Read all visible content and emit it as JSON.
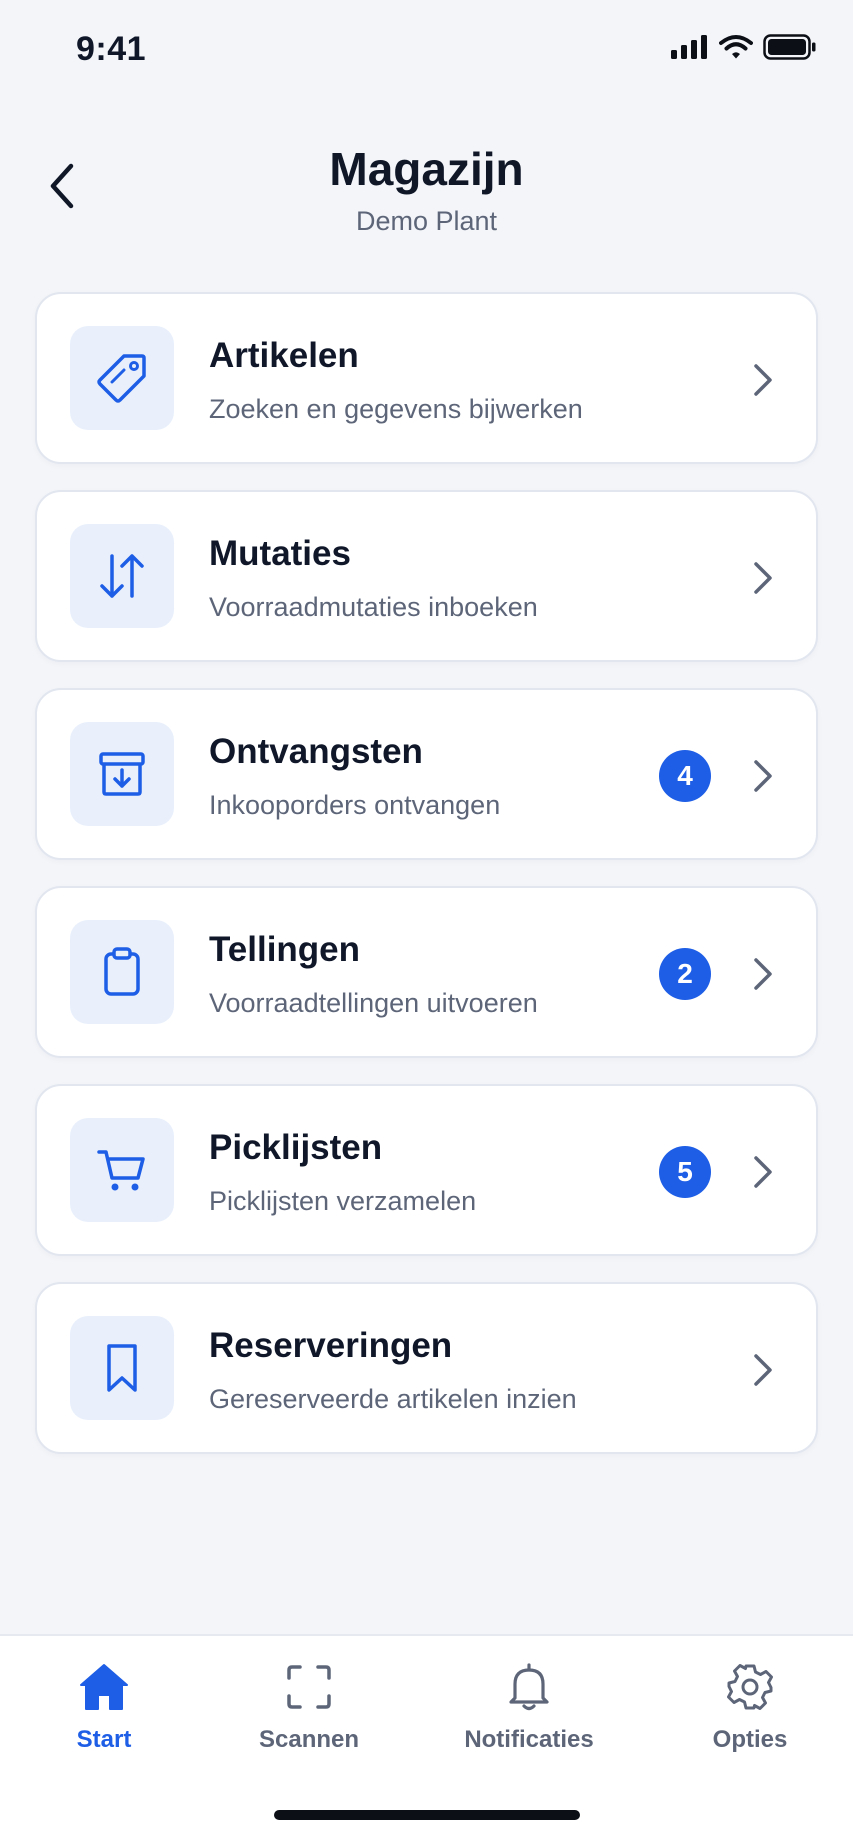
{
  "status_bar": {
    "time": "9:41"
  },
  "header": {
    "title": "Magazijn",
    "subtitle": "Demo Plant"
  },
  "menu": [
    {
      "title": "Artikelen",
      "subtitle": "Zoeken en gegevens bijwerken",
      "icon": "tag-icon",
      "badge": null
    },
    {
      "title": "Mutaties",
      "subtitle": "Voorraadmutaties inboeken",
      "icon": "arrows-up-down-icon",
      "badge": null
    },
    {
      "title": "Ontvangsten",
      "subtitle": "Inkooporders ontvangen",
      "icon": "archive-download-icon",
      "badge": "4"
    },
    {
      "title": "Tellingen",
      "subtitle": "Voorraadtellingen uitvoeren",
      "icon": "clipboard-icon",
      "badge": "2"
    },
    {
      "title": "Picklijsten",
      "subtitle": "Picklijsten verzamelen",
      "icon": "cart-icon",
      "badge": "5"
    },
    {
      "title": "Reserveringen",
      "subtitle": "Gereserveerde artikelen inzien",
      "icon": "bookmark-icon",
      "badge": null
    }
  ],
  "bottom_nav": [
    {
      "label": "Start",
      "icon": "home-icon",
      "active": true
    },
    {
      "label": "Scannen",
      "icon": "scan-icon",
      "active": false
    },
    {
      "label": "Notificaties",
      "icon": "bell-icon",
      "active": false
    },
    {
      "label": "Opties",
      "icon": "gear-icon",
      "active": false
    }
  ],
  "colors": {
    "accent": "#1e5ee6",
    "icon_tile": "#e9f0fc",
    "background": "#f3f5f9"
  }
}
